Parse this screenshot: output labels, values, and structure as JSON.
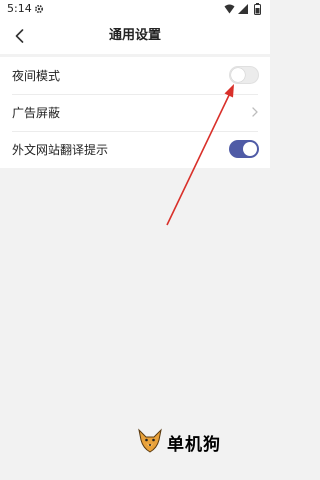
{
  "status_bar": {
    "time": "5:14",
    "icons": [
      "settings-gear-icon",
      "wifi-icon",
      "signal-icon",
      "battery-icon"
    ]
  },
  "header": {
    "back_icon": "chevron-left-icon",
    "title": "通用设置"
  },
  "settings": {
    "items": [
      {
        "label": "夜间模式",
        "control": "toggle",
        "checked": false
      },
      {
        "label": "广告屏蔽",
        "control": "chevron-right-icon"
      },
      {
        "label": "外文网站翻译提示",
        "control": "toggle",
        "checked": true
      }
    ]
  },
  "colors": {
    "toggle_on": "#4f5ba6",
    "toggle_off": "#ececec",
    "annotation_arrow": "#d9302a",
    "background": "#f2f2f2"
  },
  "watermark": {
    "text": "单机狗",
    "icon": "fox-mascot-logo"
  }
}
